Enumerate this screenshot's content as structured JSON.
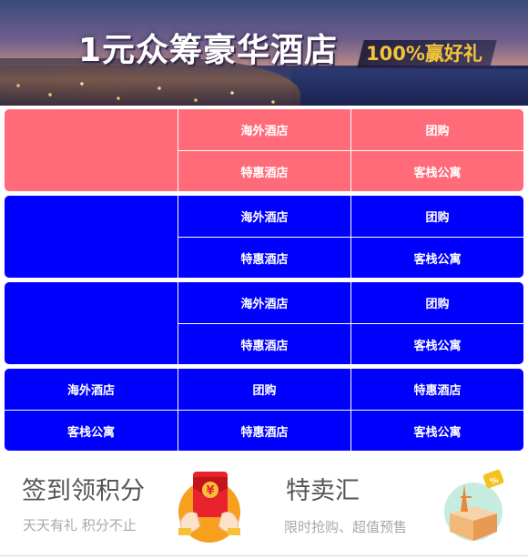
{
  "banner": {
    "title": "1元众筹豪华酒店",
    "tag": "100%赢好礼"
  },
  "blocks": [
    {
      "color": "#ff6b78",
      "layout": "left-image",
      "cells": [
        "海外酒店",
        "团购",
        "特惠酒店",
        "客栈公寓"
      ]
    },
    {
      "color": "#0000ff",
      "layout": "left-image",
      "cells": [
        "海外酒店",
        "团购",
        "特惠酒店",
        "客栈公寓"
      ]
    },
    {
      "color": "#0000ff",
      "layout": "left-image",
      "cells": [
        "海外酒店",
        "团购",
        "特惠酒店",
        "客栈公寓"
      ]
    },
    {
      "color": "#0000ff",
      "layout": "full",
      "cells": [
        "海外酒店",
        "团购",
        "特惠酒店",
        "客栈公寓",
        "特惠酒店",
        "客栈公寓"
      ]
    }
  ],
  "promos": [
    {
      "title": "签到领积分",
      "subtitle": "天天有礼 积分不止",
      "icon": "red-envelope-icon"
    },
    {
      "title": "特卖汇",
      "subtitle": "限时抢购、超值预售",
      "icon": "gift-box-icon"
    }
  ]
}
